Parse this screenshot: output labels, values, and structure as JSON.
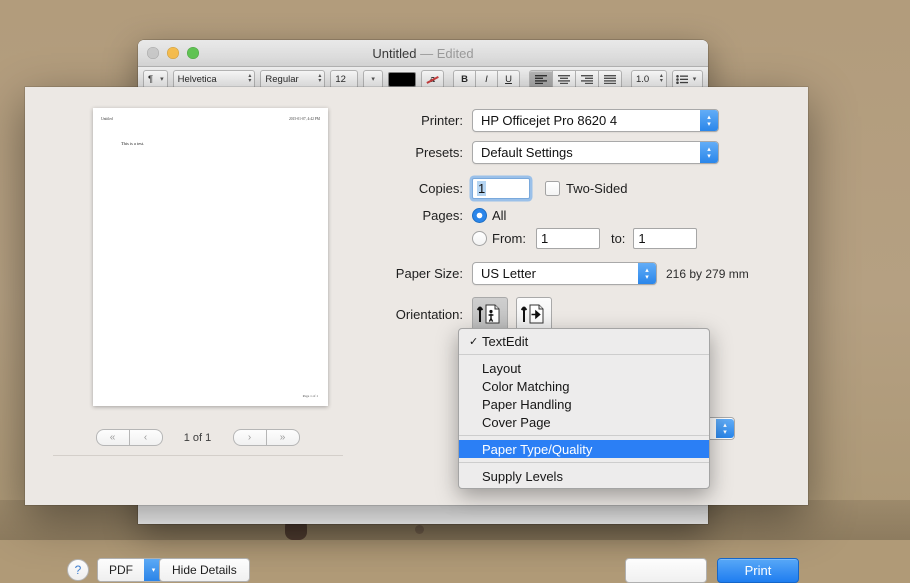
{
  "desktop": {
    "wallpaper_color": "#b29c7c"
  },
  "textedit": {
    "title": "Untitled",
    "dash": "—",
    "edited": "Edited",
    "traffic": {
      "close": "close-button",
      "minimize": "minimize-button",
      "zoom": "zoom-button"
    },
    "toolbar": {
      "paragraph_icon": "¶",
      "font_family": "Helvetica",
      "font_style": "Regular",
      "font_size": "12",
      "text_color": "#000000",
      "highlight_icon": "a",
      "bold": "B",
      "italic": "I",
      "underline": "U",
      "align_left": "align-left",
      "align_center": "align-center",
      "align_right": "align-right",
      "align_justify": "align-justify",
      "line_spacing": "1.0",
      "list_icon": "list"
    }
  },
  "preview": {
    "doc_header_left": "Untitled",
    "doc_header_right": "2015-01-07, 4:42 PM",
    "doc_body": "This is a test.",
    "doc_footer": "Page 1 of 1",
    "pager": {
      "first": "«",
      "prev": "‹",
      "text": "1 of 1",
      "next": "›",
      "last": "»"
    }
  },
  "form": {
    "printer": {
      "label": "Printer:",
      "value": "HP Officejet Pro 8620 4"
    },
    "presets": {
      "label": "Presets:",
      "value": "Default Settings"
    },
    "copies": {
      "label": "Copies:",
      "value": "1",
      "two_sided_label": "Two-Sided",
      "two_sided_checked": false
    },
    "pages": {
      "label": "Pages:",
      "all_label": "All",
      "all_selected": true,
      "from_label": "From:",
      "from_value": "1",
      "to_label": "to:",
      "to_value": "1"
    },
    "paper_size": {
      "label": "Paper Size:",
      "value": "US Letter",
      "units": "216 by 279 mm"
    },
    "orientation": {
      "label": "Orientation:",
      "portrait_selected": true,
      "portrait_name": "portrait-orientation",
      "landscape_name": "landscape-orientation"
    }
  },
  "menu": {
    "checked_item": "TextEdit",
    "check_glyph": "✓",
    "items": [
      "Layout",
      "Color Matching",
      "Paper Handling",
      "Cover Page"
    ],
    "highlighted": "Paper Type/Quality",
    "last_item": "Supply Levels",
    "highlight_color": "#2b7ff5"
  },
  "bottom": {
    "help": "?",
    "pdf": "PDF",
    "hide_details": "Hide Details",
    "print": "Print"
  }
}
